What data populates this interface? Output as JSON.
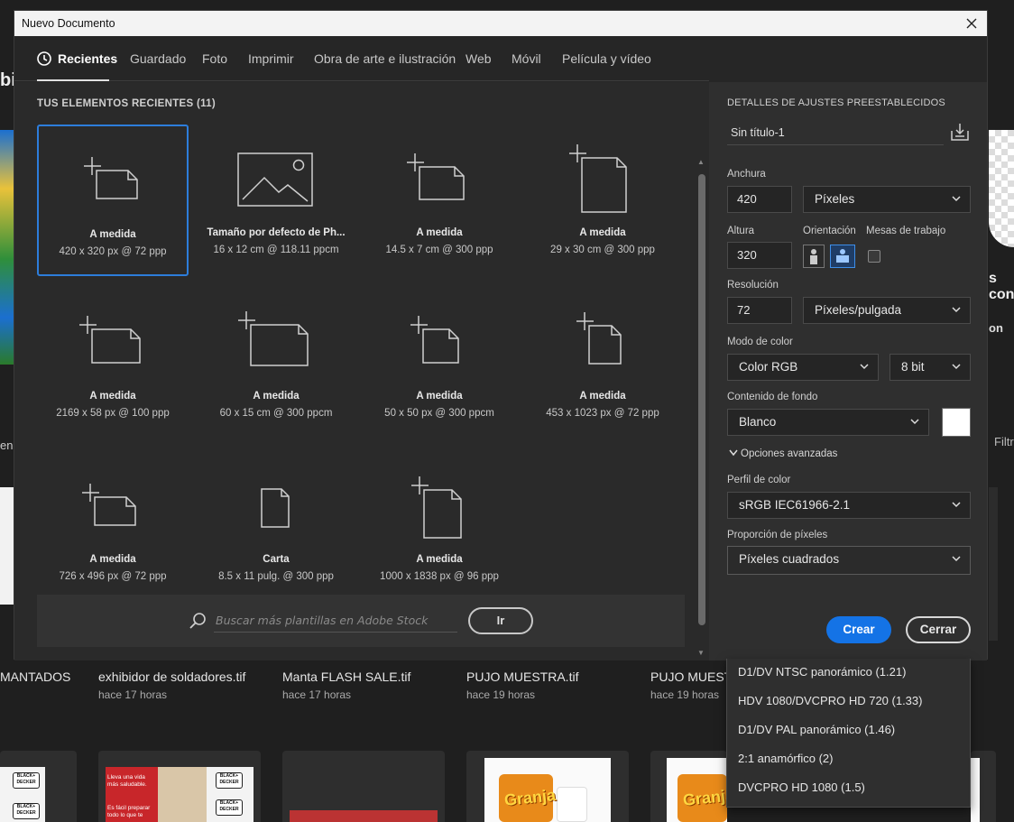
{
  "background": {
    "left_fragment": "bi",
    "left_fragment2": "en",
    "right_fragment": "s con",
    "right_fragment2": "on",
    "filter_label": "Filtr",
    "files": [
      {
        "name": "MANTADOS",
        "time": ""
      },
      {
        "name": "exhibidor de soldadores.tif",
        "time": "hace 17 horas"
      },
      {
        "name": "Manta FLASH SALE.tif",
        "time": "hace 17 horas"
      },
      {
        "name": "PUJO MUESTRA.tif",
        "time": "hace 19 horas"
      },
      {
        "name": "PUJO MUESTR",
        "time": "hace 19 horas"
      }
    ],
    "thumb_texts": {
      "logo": "BLACK+ DECKER",
      "promo1": "Lleva una vida más saludable.",
      "promo2": "Es fácil preparar todo lo que te",
      "brand": "Granja"
    }
  },
  "dialog": {
    "title": "Nuevo Documento",
    "tabs": [
      "Recientes",
      "Guardado",
      "Foto",
      "Imprimir",
      "Obra de arte e ilustración",
      "Web",
      "Móvil",
      "Película y vídeo"
    ],
    "recent_title": "TUS ELEMENTOS RECIENTES  (11)",
    "recents": [
      {
        "name": "A medida",
        "size": "420 x 320 px @ 72 ppp"
      },
      {
        "name": "Tamaño por defecto de Ph...",
        "size": "16 x 12 cm @ 118.11 ppcm"
      },
      {
        "name": "A medida",
        "size": "14.5 x 7 cm @ 300 ppp"
      },
      {
        "name": "A medida",
        "size": "29 x 30 cm @ 300 ppp"
      },
      {
        "name": "A medida",
        "size": "2169 x 58 px @ 100 ppp"
      },
      {
        "name": "A medida",
        "size": "60 x 15 cm @ 300 ppcm"
      },
      {
        "name": "A medida",
        "size": "50 x 50 px @ 300 ppcm"
      },
      {
        "name": "A medida",
        "size": "453 x 1023 px @ 72 ppp"
      },
      {
        "name": "A medida",
        "size": "726 x 496 px @ 72 ppp"
      },
      {
        "name": "Carta",
        "size": "8.5 x 11 pulg. @ 300 ppp"
      },
      {
        "name": "A medida",
        "size": "1000 x 1838 px @ 96 ppp"
      }
    ],
    "search": {
      "placeholder": "Buscar más plantillas en Adobe Stock",
      "button": "Ir"
    },
    "preset": {
      "title": "DETALLES DE AJUSTES PREESTABLECIDOS",
      "doc_name": "Sin título-1",
      "width_label": "Anchura",
      "width": "420",
      "width_unit": "Píxeles",
      "height_label": "Altura",
      "height": "320",
      "orientation_label": "Orientación",
      "artboards_label": "Mesas de trabajo",
      "resolution_label": "Resolución",
      "resolution": "72",
      "resolution_unit": "Píxeles/pulgada",
      "color_mode_label": "Modo de color",
      "color_mode": "Color RGB",
      "bit_depth": "8 bit",
      "background_label": "Contenido de fondo",
      "background": "Blanco",
      "background_color": "#ffffff",
      "advanced": "Opciones avanzadas",
      "color_profile_label": "Perfil de color",
      "color_profile": "sRGB IEC61966-2.1",
      "pixel_aspect_label": "Proporción de píxeles",
      "pixel_aspect": "Píxeles cuadrados",
      "pixel_aspect_options": [
        "D1/DV NTSC panorámico (1.21)",
        "HDV 1080/DVCPRO HD 720 (1.33)",
        "D1/DV PAL panorámico (1.46)",
        "2:1 anamórfico (2)",
        "DVCPRO HD 1080 (1.5)"
      ],
      "create": "Crear",
      "close": "Cerrar"
    },
    "accent_color": "#1473e6"
  }
}
